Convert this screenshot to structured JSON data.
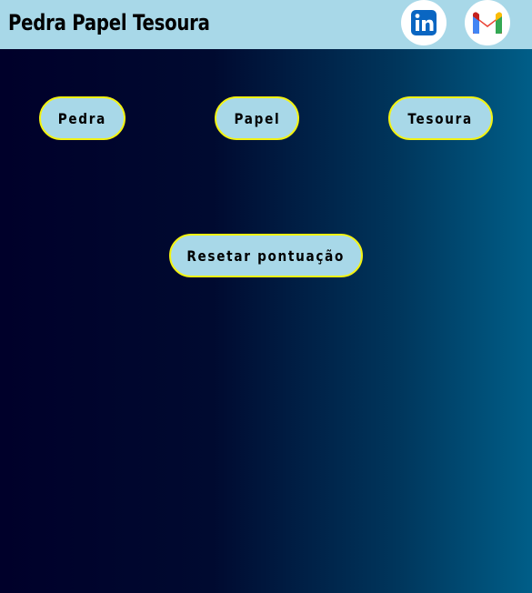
{
  "header": {
    "title": "Pedra Papel Tesoura",
    "social": [
      {
        "name": "linkedin-icon",
        "label": "in",
        "color": "#0a66c2"
      },
      {
        "name": "gmail-icon",
        "label": "M"
      }
    ],
    "background_color": "#a8d8e8"
  },
  "game": {
    "choices": [
      "Pedra",
      "Papel",
      "Tesoura"
    ],
    "reset_label": "Resetar pontuação"
  },
  "colors": {
    "button_bg": "#a8d8e8",
    "button_border": "#f3f312",
    "gradient_start": "#00002a",
    "gradient_end": "#005e88"
  }
}
